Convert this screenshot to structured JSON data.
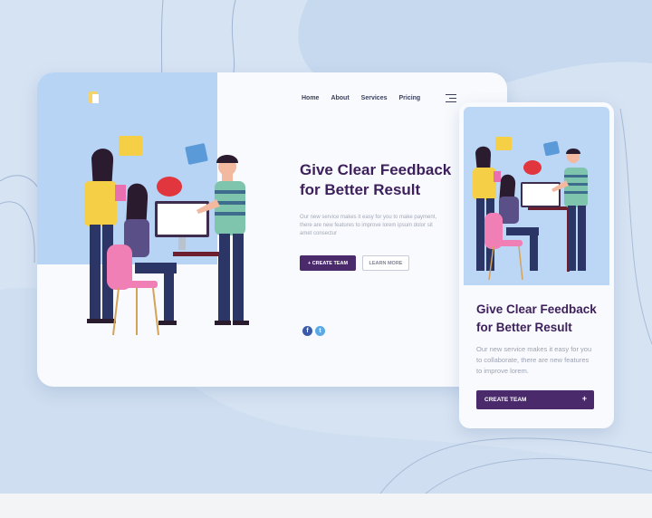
{
  "desktop": {
    "nav": [
      "Home",
      "About",
      "Services",
      "Pricing"
    ],
    "title_line1": "Give Clear Feedback",
    "title_line2": "for Better Result",
    "description": "Our new service makes it easy for you to make payment, there are new features to improve lorem ipsum dolor sit amet consectur",
    "create_label": "+ CREATE TEAM",
    "learn_label": "LEARN MORE",
    "social": {
      "facebook": "f",
      "twitter": "t"
    }
  },
  "mobile": {
    "title_line1": "Give Clear Feedback",
    "title_line2": "for Better Result",
    "description": "Our new service makes it easy for you to collaborate, there are new features to improve lorem.",
    "create_label": "CREATE TEAM",
    "create_icon": "+"
  },
  "colors": {
    "accent": "#4a2a6b",
    "title": "#3d1f5c",
    "illustration_bg": "#b8d4f5",
    "page_bg": "#d6e3f3"
  },
  "icons": [
    "logo-icon",
    "menu-icon",
    "facebook-icon",
    "twitter-icon",
    "plus-icon"
  ]
}
